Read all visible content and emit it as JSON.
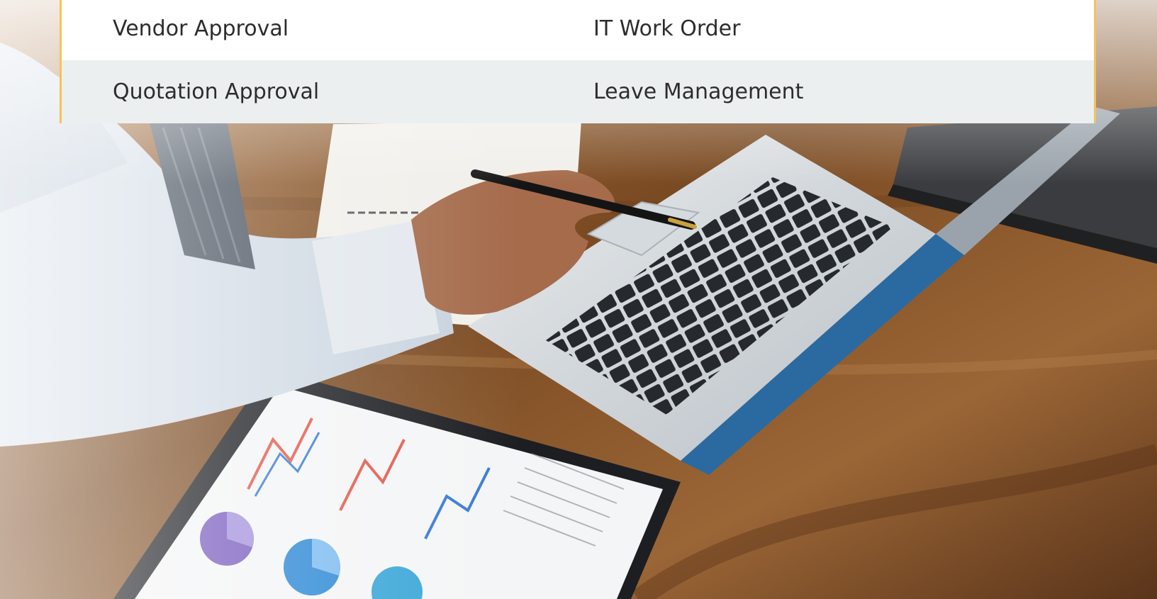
{
  "services": {
    "rows": [
      [
        "Vendor Approval",
        "IT Work Order"
      ],
      [
        "Quotation Approval",
        "Leave Management"
      ]
    ]
  },
  "colors": {
    "panel_border": "#f6c25a",
    "panel_row_alt": "#eceff0",
    "text": "#2d2d2d",
    "desk_wood": "#8a5a2e"
  },
  "background": {
    "icon": "business-desk-photo"
  }
}
